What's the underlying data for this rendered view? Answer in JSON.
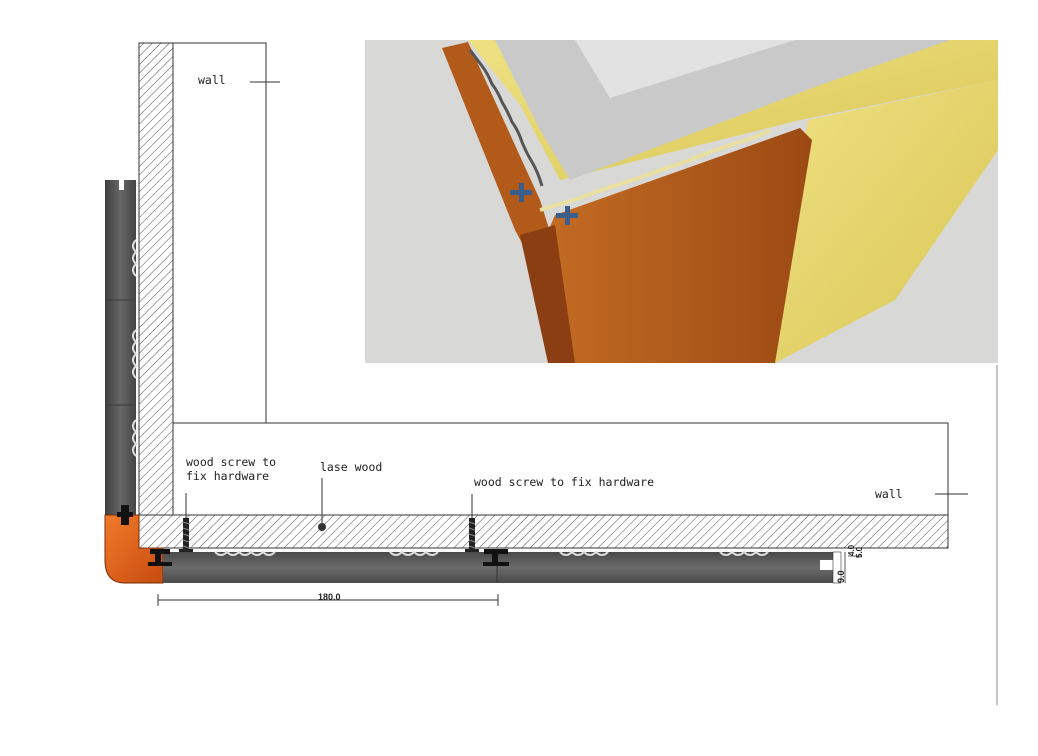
{
  "labels": {
    "wall_left": "wall",
    "wall_right": "wall",
    "screw_left_line1": "wood screw to",
    "screw_left_line2": "fix hardware",
    "base_wood": "lase wood",
    "screw_right": "wood screw to fix hardware"
  },
  "dimensions": {
    "panel_width": "180.0",
    "panel_thickness": "9.0",
    "gap_a": "4.0",
    "gap_b": "5.0"
  },
  "colors": {
    "hatch": "#555555",
    "panel_dark": "#5e5e5e",
    "corner_orange": "#e2621c",
    "render_bg": "#d8d8d6",
    "insulation": "#e4d46a",
    "wood": "#b5601c"
  },
  "icons": {
    "clip": "t-clip-icon",
    "screw": "screw-icon",
    "point": "dot-icon"
  }
}
